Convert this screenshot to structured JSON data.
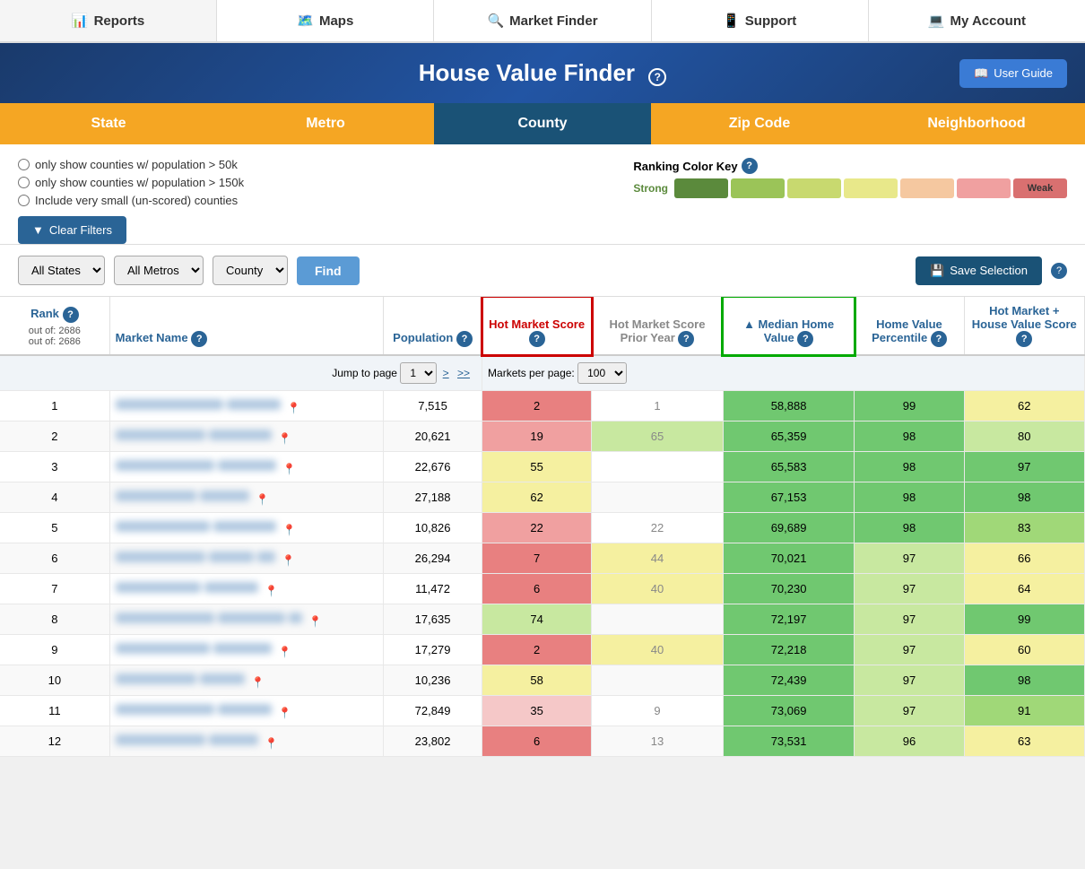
{
  "nav": {
    "items": [
      {
        "label": "Reports",
        "icon": "📊"
      },
      {
        "label": "Maps",
        "icon": "🗺️"
      },
      {
        "label": "Market Finder",
        "icon": "🔍"
      },
      {
        "label": "Support",
        "icon": "📱"
      },
      {
        "label": "My Account",
        "icon": "💻"
      }
    ]
  },
  "hero": {
    "title": "House Value Finder",
    "guide_label": "User Guide"
  },
  "tabs": [
    {
      "label": "State",
      "active": false
    },
    {
      "label": "Metro",
      "active": false
    },
    {
      "label": "County",
      "active": true
    },
    {
      "label": "Zip Code",
      "active": false
    },
    {
      "label": "Neighborhood",
      "active": false
    }
  ],
  "filters": {
    "radio1": "only show counties w/ population > 50k",
    "radio2": "only show counties w/ population > 150k",
    "radio3": "Include very small (un-scored) counties",
    "clear_label": "Clear Filters"
  },
  "color_key": {
    "title": "Ranking Color Key",
    "strong_label": "Strong",
    "weak_label": "Weak"
  },
  "selects": {
    "states": {
      "value": "All States",
      "options": [
        "All States"
      ]
    },
    "metros": {
      "value": "All Metros",
      "options": [
        "All Metros"
      ]
    },
    "county": {
      "value": "County",
      "options": [
        "County"
      ]
    },
    "find_label": "Find",
    "save_label": "Save Selection"
  },
  "table": {
    "headers": [
      {
        "label": "Rank",
        "sub": "out of: 2686",
        "help": true
      },
      {
        "label": "Market Name",
        "sub": "",
        "help": true
      },
      {
        "label": "Population",
        "sub": "",
        "help": true
      },
      {
        "label": "Hot Market Score",
        "sub": "",
        "help": true
      },
      {
        "label": "Hot Market Score Prior Year",
        "sub": "",
        "help": true
      },
      {
        "label": "▲ Median Home Value",
        "sub": "",
        "help": true
      },
      {
        "label": "Home Value Percentile",
        "sub": "",
        "help": true
      },
      {
        "label": "Hot Market + House Value Score",
        "sub": "",
        "help": true
      }
    ],
    "pagination": {
      "jump_label": "Jump to page",
      "page_value": "1",
      "markets_label": "Markets per page:",
      "per_page_value": "100"
    },
    "rows": [
      {
        "rank": 1,
        "pop": "7,515",
        "hot": 2,
        "hot_prior": 1,
        "median": "58,888",
        "hv_pct": 99,
        "hot_hv": 62,
        "hot_class": "cell-red-dark",
        "median_class": "cell-green-dark",
        "hv_pct_class": "cell-green-dark",
        "hot_hv_class": "cell-yellow"
      },
      {
        "rank": 2,
        "pop": "20,621",
        "hot": 19,
        "hot_prior": 65,
        "median": "65,359",
        "hv_pct": 98,
        "hot_hv": 80,
        "hot_class": "cell-red",
        "median_class": "cell-green-dark",
        "hv_pct_class": "cell-green-dark",
        "hot_hv_class": "cell-green-light"
      },
      {
        "rank": 3,
        "pop": "22,676",
        "hot": 55,
        "hot_prior": "",
        "median": "65,583",
        "hv_pct": 98,
        "hot_hv": 97,
        "hot_class": "cell-yellow",
        "median_class": "cell-green-dark",
        "hv_pct_class": "cell-green-dark",
        "hot_hv_class": "cell-green-dark"
      },
      {
        "rank": 4,
        "pop": "27,188",
        "hot": 62,
        "hot_prior": "",
        "median": "67,153",
        "hv_pct": 98,
        "hot_hv": 98,
        "hot_class": "cell-yellow",
        "median_class": "cell-green-dark",
        "hv_pct_class": "cell-green-dark",
        "hot_hv_class": "cell-green-dark"
      },
      {
        "rank": 5,
        "pop": "10,826",
        "hot": 22,
        "hot_prior": 22,
        "median": "69,689",
        "hv_pct": 98,
        "hot_hv": 83,
        "hot_class": "cell-red",
        "median_class": "cell-green-dark",
        "hv_pct_class": "cell-green-dark",
        "hot_hv_class": "cell-green"
      },
      {
        "rank": 6,
        "pop": "26,294",
        "hot": 7,
        "hot_prior": 44,
        "median": "70,021",
        "hv_pct": 97,
        "hot_hv": 66,
        "hot_class": "cell-red-dark",
        "median_class": "cell-green-dark",
        "hv_pct_class": "cell-green-light",
        "hot_hv_class": "cell-yellow"
      },
      {
        "rank": 7,
        "pop": "11,472",
        "hot": 6,
        "hot_prior": 40,
        "median": "70,230",
        "hv_pct": 97,
        "hot_hv": 64,
        "hot_class": "cell-red-dark",
        "median_class": "cell-green-dark",
        "hv_pct_class": "cell-green-light",
        "hot_hv_class": "cell-yellow"
      },
      {
        "rank": 8,
        "pop": "17,635",
        "hot": 74,
        "hot_prior": "",
        "median": "72,197",
        "hv_pct": 97,
        "hot_hv": 99,
        "hot_class": "cell-green-light",
        "median_class": "cell-green-dark",
        "hv_pct_class": "cell-green-light",
        "hot_hv_class": "cell-green-dark"
      },
      {
        "rank": 9,
        "pop": "17,279",
        "hot": 2,
        "hot_prior": 40,
        "median": "72,218",
        "hv_pct": 97,
        "hot_hv": 60,
        "hot_class": "cell-red-dark",
        "median_class": "cell-green-dark",
        "hv_pct_class": "cell-green-light",
        "hot_hv_class": "cell-yellow"
      },
      {
        "rank": 10,
        "pop": "10,236",
        "hot": 58,
        "hot_prior": "",
        "median": "72,439",
        "hv_pct": 97,
        "hot_hv": 98,
        "hot_class": "cell-yellow",
        "median_class": "cell-green-dark",
        "hv_pct_class": "cell-green-light",
        "hot_hv_class": "cell-green-dark"
      },
      {
        "rank": 11,
        "pop": "72,849",
        "hot": 35,
        "hot_prior": 9,
        "median": "73,069",
        "hv_pct": 97,
        "hot_hv": 91,
        "hot_class": "cell-pink",
        "median_class": "cell-green-dark",
        "hv_pct_class": "cell-green-light",
        "hot_hv_class": "cell-green"
      },
      {
        "rank": 12,
        "pop": "23,802",
        "hot": 6,
        "hot_prior": 13,
        "median": "73,531",
        "hv_pct": 96,
        "hot_hv": 63,
        "hot_class": "cell-red-dark",
        "median_class": "cell-green-dark",
        "hv_pct_class": "cell-green-light",
        "hot_hv_class": "cell-yellow"
      }
    ]
  }
}
